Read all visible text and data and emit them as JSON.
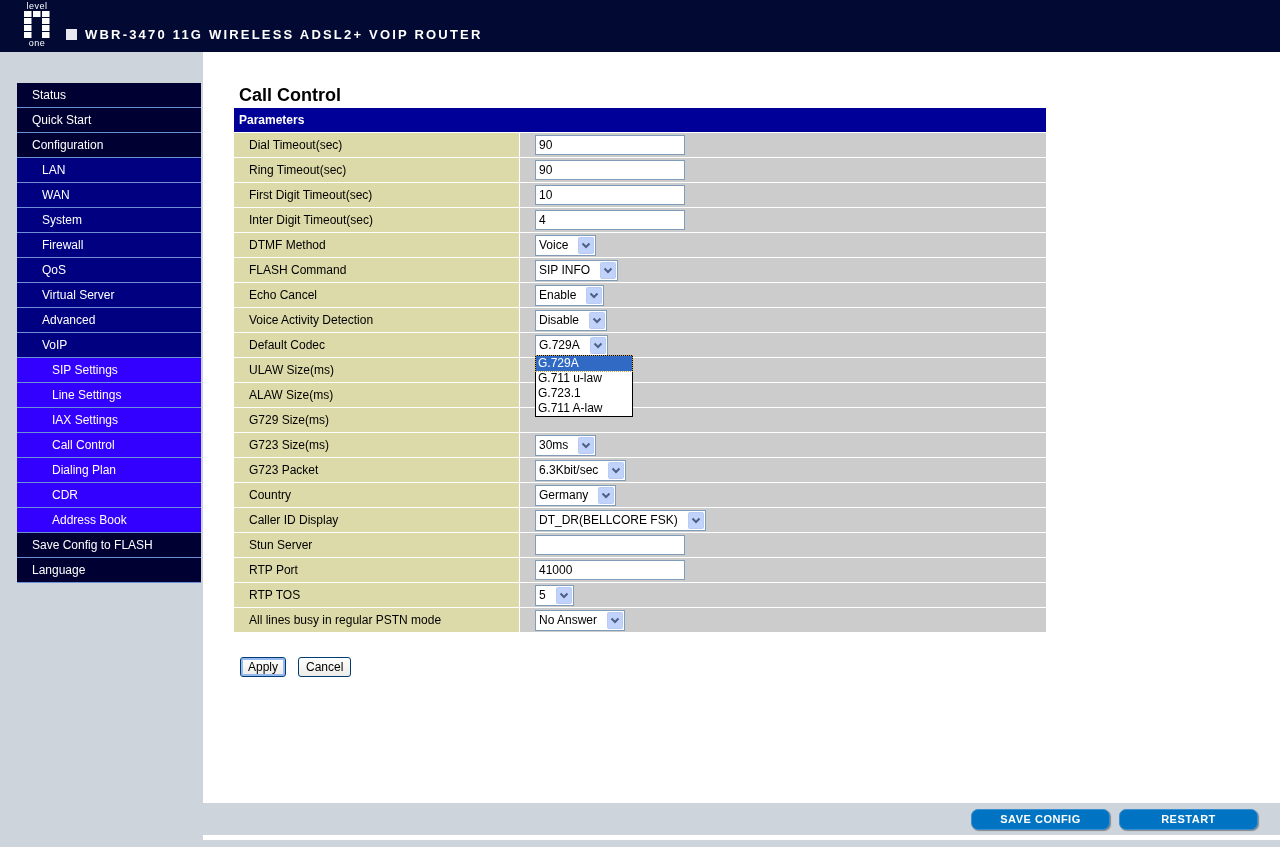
{
  "header": {
    "logo_top": "level",
    "logo_bottom": "one",
    "title": "WBR-3470 11G WIRELESS ADSL2+ VOIP ROUTER"
  },
  "sidebar": {
    "items": [
      {
        "label": "Status"
      },
      {
        "label": "Quick Start"
      },
      {
        "label": "Configuration",
        "children": [
          {
            "label": "LAN"
          },
          {
            "label": "WAN"
          },
          {
            "label": "System"
          },
          {
            "label": "Firewall"
          },
          {
            "label": "QoS"
          },
          {
            "label": "Virtual Server"
          },
          {
            "label": "Advanced"
          },
          {
            "label": "VoIP",
            "children": [
              {
                "label": "SIP Settings"
              },
              {
                "label": "Line Settings"
              },
              {
                "label": "IAX Settings"
              },
              {
                "label": "Call Control"
              },
              {
                "label": "Dialing Plan"
              },
              {
                "label": "CDR"
              },
              {
                "label": "Address Book"
              }
            ]
          }
        ]
      },
      {
        "label": "Save Config to FLASH"
      },
      {
        "label": "Language"
      }
    ]
  },
  "page_title": "Call Control",
  "table": {
    "header": "Parameters",
    "rows": [
      {
        "label": "Dial Timeout(sec)",
        "field": {
          "kind": "text",
          "value": "90"
        }
      },
      {
        "label": "Ring Timeout(sec)",
        "field": {
          "kind": "text",
          "value": "90"
        }
      },
      {
        "label": "First Digit Timeout(sec)",
        "field": {
          "kind": "text",
          "value": "10"
        }
      },
      {
        "label": "Inter Digit Timeout(sec)",
        "field": {
          "kind": "text",
          "value": "4"
        }
      },
      {
        "label": "DTMF Method",
        "field": {
          "kind": "select",
          "value": "Voice"
        }
      },
      {
        "label": "FLASH Command",
        "field": {
          "kind": "select",
          "value": "SIP INFO"
        }
      },
      {
        "label": "Echo Cancel",
        "field": {
          "kind": "select",
          "value": "Enable"
        }
      },
      {
        "label": "Voice Activity Detection",
        "field": {
          "kind": "select",
          "value": "Disable"
        }
      },
      {
        "label": "Default Codec",
        "field": {
          "kind": "select",
          "value": "G.729A",
          "expanded": true,
          "options": [
            {
              "label": "G.729A",
              "selected": true
            },
            {
              "label": "G.711 u-law",
              "selected": false
            },
            {
              "label": "G.723.1",
              "selected": false
            },
            {
              "label": "G.711 A-law",
              "selected": false
            }
          ]
        }
      },
      {
        "label": "ULAW Size(ms)"
      },
      {
        "label": "ALAW Size(ms)"
      },
      {
        "label": "G729 Size(ms)"
      },
      {
        "label": "G723 Size(ms)",
        "field": {
          "kind": "select",
          "value": "30ms"
        }
      },
      {
        "label": "G723 Packet",
        "field": {
          "kind": "select",
          "value": "6.3Kbit/sec"
        }
      },
      {
        "label": "Country",
        "field": {
          "kind": "select",
          "value": "Germany"
        }
      },
      {
        "label": "Caller ID Display",
        "field": {
          "kind": "select",
          "value": "DT_DR(BELLCORE FSK)"
        }
      },
      {
        "label": "Stun Server",
        "field": {
          "kind": "text"
        }
      },
      {
        "label": "RTP Port",
        "field": {
          "kind": "text",
          "value": "41000"
        }
      },
      {
        "label": "RTP TOS",
        "field": {
          "kind": "select",
          "value": "5"
        }
      },
      {
        "label": "All lines busy in regular PSTN mode",
        "field": {
          "kind": "select",
          "value": "No Answer"
        }
      }
    ]
  },
  "form_buttons": [
    {
      "label": "Apply",
      "focused": true
    },
    {
      "label": "Cancel",
      "focused": false
    }
  ],
  "footer_buttons": [
    "SAVE CONFIG",
    "RESTART"
  ]
}
